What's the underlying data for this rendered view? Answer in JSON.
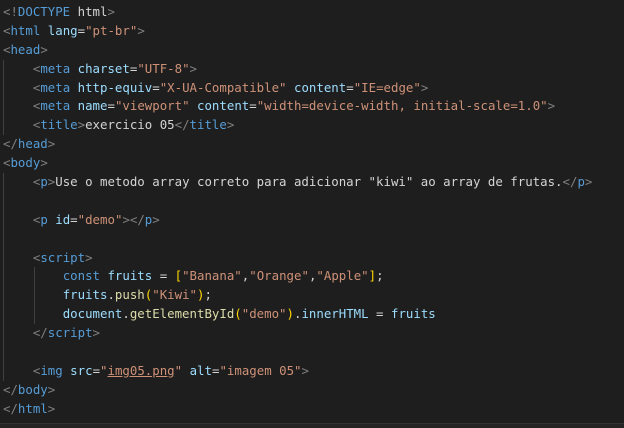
{
  "editor": {
    "language": "html",
    "colors": {
      "background": "#1e1e1e",
      "tag": "#569cd6",
      "attribute": "#9cdcfe",
      "string": "#ce9178",
      "punctuation": "#808080",
      "text": "#d4d4d4",
      "function": "#dcdcaa",
      "bracket_level1": "#ffd700",
      "bracket_level2": "#da70d6",
      "indent_guide": "#404040"
    },
    "lines": [
      {
        "indent": 0,
        "tokens": [
          [
            "punct",
            "<!"
          ],
          [
            "doctype",
            "DOCTYPE"
          ],
          [
            "plain",
            " "
          ],
          [
            "text",
            "html"
          ],
          [
            "punct",
            ">"
          ]
        ]
      },
      {
        "indent": 0,
        "tokens": [
          [
            "punct",
            "<"
          ],
          [
            "tag",
            "html"
          ],
          [
            "plain",
            " "
          ],
          [
            "attr",
            "lang"
          ],
          [
            "text",
            "="
          ],
          [
            "str",
            "\"pt-br\""
          ],
          [
            "punct",
            ">"
          ]
        ]
      },
      {
        "indent": 0,
        "tokens": [
          [
            "punct",
            "<"
          ],
          [
            "tag",
            "head"
          ],
          [
            "punct",
            ">"
          ]
        ]
      },
      {
        "indent": 1,
        "tokens": [
          [
            "punct",
            "<"
          ],
          [
            "tag",
            "meta"
          ],
          [
            "plain",
            " "
          ],
          [
            "attr",
            "charset"
          ],
          [
            "text",
            "="
          ],
          [
            "str",
            "\"UTF-8\""
          ],
          [
            "punct",
            ">"
          ]
        ]
      },
      {
        "indent": 1,
        "tokens": [
          [
            "punct",
            "<"
          ],
          [
            "tag",
            "meta"
          ],
          [
            "plain",
            " "
          ],
          [
            "attr",
            "http-equiv"
          ],
          [
            "text",
            "="
          ],
          [
            "str",
            "\"X-UA-Compatible\""
          ],
          [
            "plain",
            " "
          ],
          [
            "attr",
            "content"
          ],
          [
            "text",
            "="
          ],
          [
            "str",
            "\"IE=edge\""
          ],
          [
            "punct",
            ">"
          ]
        ]
      },
      {
        "indent": 1,
        "tokens": [
          [
            "punct",
            "<"
          ],
          [
            "tag",
            "meta"
          ],
          [
            "plain",
            " "
          ],
          [
            "attr",
            "name"
          ],
          [
            "text",
            "="
          ],
          [
            "str",
            "\"viewport\""
          ],
          [
            "plain",
            " "
          ],
          [
            "attr",
            "content"
          ],
          [
            "text",
            "="
          ],
          [
            "str",
            "\"width=device-width, initial-scale=1.0\""
          ],
          [
            "punct",
            ">"
          ]
        ]
      },
      {
        "indent": 1,
        "tokens": [
          [
            "punct",
            "<"
          ],
          [
            "tag",
            "title"
          ],
          [
            "punct",
            ">"
          ],
          [
            "text",
            "exercicio 05"
          ],
          [
            "punct",
            "</"
          ],
          [
            "tag",
            "title"
          ],
          [
            "punct",
            ">"
          ]
        ]
      },
      {
        "indent": 0,
        "tokens": [
          [
            "punct",
            "</"
          ],
          [
            "tag",
            "head"
          ],
          [
            "punct",
            ">"
          ]
        ]
      },
      {
        "indent": 0,
        "tokens": [
          [
            "punct",
            "<"
          ],
          [
            "tag",
            "body"
          ],
          [
            "punct",
            ">"
          ]
        ]
      },
      {
        "indent": 1,
        "tokens": [
          [
            "punct",
            "<"
          ],
          [
            "tag",
            "p"
          ],
          [
            "punct",
            ">"
          ],
          [
            "text",
            "Use o metodo array correto para adicionar \"kiwi\" ao array de frutas."
          ],
          [
            "punct",
            "</"
          ],
          [
            "tag",
            "p"
          ],
          [
            "punct",
            ">"
          ]
        ]
      },
      {
        "indent": 1,
        "tokens": []
      },
      {
        "indent": 1,
        "tokens": [
          [
            "punct",
            "<"
          ],
          [
            "tag",
            "p"
          ],
          [
            "plain",
            " "
          ],
          [
            "attr",
            "id"
          ],
          [
            "text",
            "="
          ],
          [
            "str",
            "\"demo\""
          ],
          [
            "punct",
            "></"
          ],
          [
            "tag",
            "p"
          ],
          [
            "punct",
            ">"
          ]
        ]
      },
      {
        "indent": 1,
        "tokens": []
      },
      {
        "indent": 1,
        "tokens": [
          [
            "punct",
            "<"
          ],
          [
            "tag",
            "script"
          ],
          [
            "punct",
            ">"
          ]
        ]
      },
      {
        "indent": 2,
        "tokens": [
          [
            "keyword",
            "const"
          ],
          [
            "plain",
            " "
          ],
          [
            "var",
            "fruits"
          ],
          [
            "op",
            " = "
          ],
          [
            "by",
            "["
          ],
          [
            "str",
            "\"Banana\""
          ],
          [
            "op",
            ","
          ],
          [
            "str",
            "\"Orange\""
          ],
          [
            "op",
            ","
          ],
          [
            "str",
            "\"Apple\""
          ],
          [
            "by",
            "]"
          ],
          [
            "op",
            ";"
          ]
        ]
      },
      {
        "indent": 2,
        "tokens": [
          [
            "var",
            "fruits"
          ],
          [
            "op",
            "."
          ],
          [
            "func",
            "push"
          ],
          [
            "by",
            "("
          ],
          [
            "str",
            "\"Kiwi\""
          ],
          [
            "by",
            ")"
          ],
          [
            "op",
            ";"
          ]
        ]
      },
      {
        "indent": 2,
        "tokens": [
          [
            "var",
            "document"
          ],
          [
            "op",
            "."
          ],
          [
            "func",
            "getElementById"
          ],
          [
            "by",
            "("
          ],
          [
            "str",
            "\"demo\""
          ],
          [
            "by",
            ")"
          ],
          [
            "op",
            "."
          ],
          [
            "var",
            "innerHTML"
          ],
          [
            "op",
            " = "
          ],
          [
            "var",
            "fruits"
          ]
        ]
      },
      {
        "indent": 1,
        "tokens": [
          [
            "punct",
            "</"
          ],
          [
            "tag",
            "script"
          ],
          [
            "punct",
            ">"
          ]
        ]
      },
      {
        "indent": 1,
        "tokens": []
      },
      {
        "indent": 1,
        "tokens": [
          [
            "punct",
            "<"
          ],
          [
            "tag",
            "img"
          ],
          [
            "plain",
            " "
          ],
          [
            "attr",
            "src"
          ],
          [
            "text",
            "="
          ],
          [
            "str",
            "\""
          ],
          [
            "link",
            "img05.png"
          ],
          [
            "str",
            "\""
          ],
          [
            "plain",
            " "
          ],
          [
            "attr",
            "alt"
          ],
          [
            "text",
            "="
          ],
          [
            "str",
            "\"imagem 05\""
          ],
          [
            "punct",
            ">"
          ]
        ]
      },
      {
        "indent": 0,
        "tokens": [
          [
            "punct",
            "</"
          ],
          [
            "tag",
            "body"
          ],
          [
            "punct",
            ">"
          ]
        ]
      },
      {
        "indent": 0,
        "tokens": [
          [
            "punct",
            "</"
          ],
          [
            "tag",
            "html"
          ],
          [
            "punct",
            ">"
          ]
        ]
      }
    ]
  }
}
